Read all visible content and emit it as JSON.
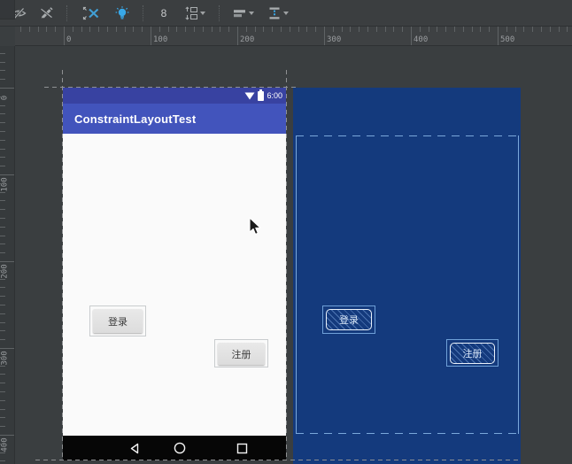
{
  "toolbar": {
    "default_margin": "8",
    "icons": {
      "view_options": "eye-off",
      "autoconnect": "pencil-off",
      "clear_constraints": "x-with-arrows",
      "infer_constraints": "lightbulb",
      "pack": "pack-selection",
      "align": "align-bars",
      "distribute": "distribute-vertical"
    }
  },
  "rulers": {
    "horizontal": [
      "0",
      "100",
      "200",
      "300",
      "400",
      "500"
    ],
    "vertical": [
      "0",
      "100",
      "200",
      "300",
      "400"
    ]
  },
  "design_view": {
    "status_bar": {
      "time": "6:00",
      "icons": [
        "wifi",
        "battery"
      ]
    },
    "app_bar": {
      "title": "ConstraintLayoutTest"
    },
    "buttons": [
      {
        "id": "login",
        "label": "登录"
      },
      {
        "id": "register",
        "label": "注册"
      }
    ],
    "nav_bar": {
      "icons": [
        "back",
        "home",
        "recents"
      ]
    }
  },
  "blueprint_view": {
    "buttons": [
      {
        "id": "login",
        "label": "登录"
      },
      {
        "id": "register",
        "label": "注册"
      }
    ]
  },
  "colors": {
    "status_bar": "#3842A1",
    "app_bar": "#4254BC",
    "content_bg": "#FAFAFA",
    "nav_bar": "#060606",
    "blueprint_bg": "#143A7D",
    "blueprint_line": "#7AA7DB",
    "toolbar_accent": "#38A8E8",
    "canvas_bg": "#3A3E40"
  }
}
